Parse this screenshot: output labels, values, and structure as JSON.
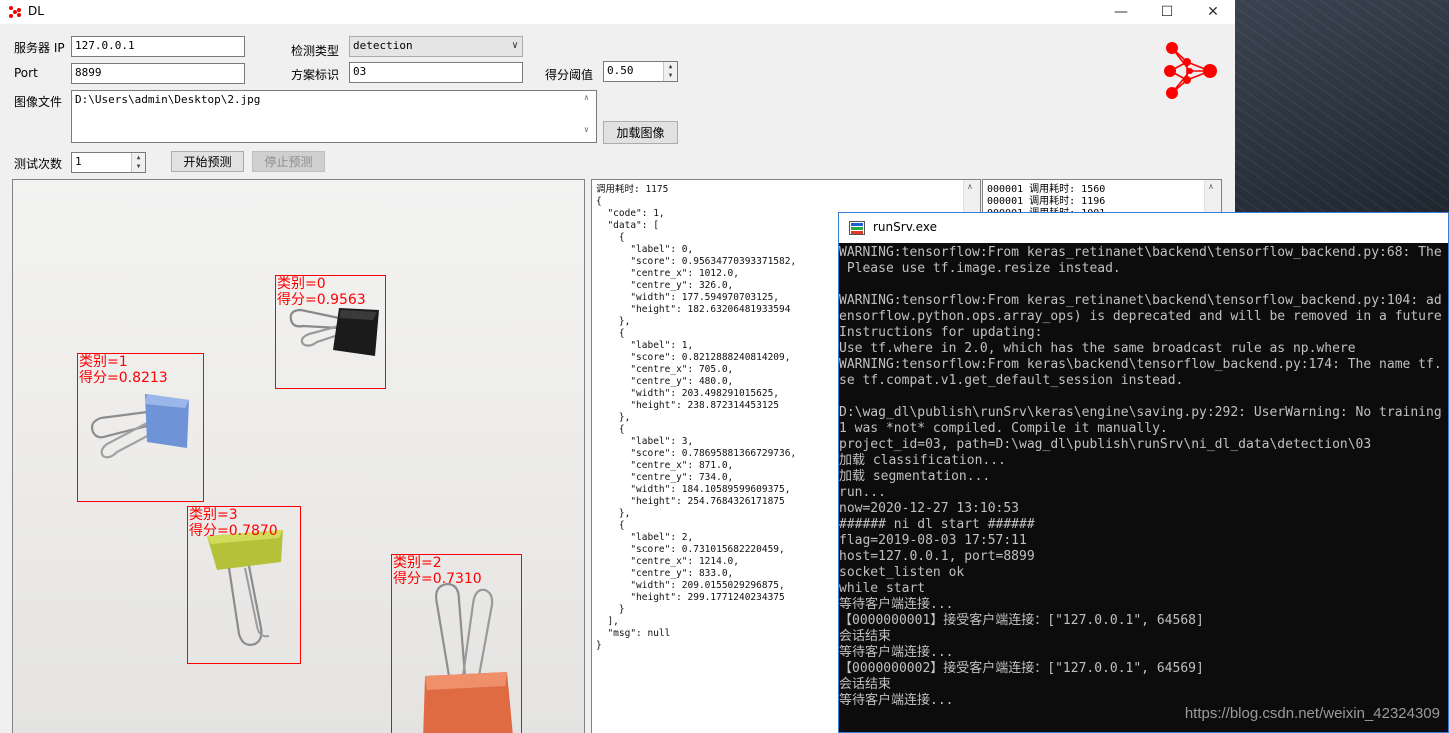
{
  "window": {
    "title": "DL",
    "minimize": "—",
    "maximize": "☐",
    "close": "✕"
  },
  "form": {
    "server_ip_label": "服务器 IP",
    "server_ip_value": "127.0.0.1",
    "port_label": "Port",
    "port_value": "8899",
    "detect_type_label": "检测类型",
    "detect_type_value": "detection",
    "scheme_label": "方案标识",
    "scheme_value": "03",
    "score_threshold_label": "得分阈值",
    "score_threshold_value": "0.50",
    "image_file_label": "图像文件",
    "image_file_value": "D:\\Users\\admin\\Desktop\\2.jpg",
    "load_image_button": "加载图像",
    "test_count_label": "测试次数",
    "test_count_value": "1",
    "start_button": "开始预测",
    "stop_button": "停止预测"
  },
  "detections": [
    {
      "class_label": "类别=0",
      "score_label": "得分=0.9563"
    },
    {
      "class_label": "类别=1",
      "score_label": "得分=0.8213"
    },
    {
      "class_label": "类别=3",
      "score_label": "得分=0.7870"
    },
    {
      "class_label": "类别=2",
      "score_label": "得分=0.7310"
    }
  ],
  "json_output": "调用耗时: 1175\n{\n  \"code\": 1,\n  \"data\": [\n    {\n      \"label\": 0,\n      \"score\": 0.95634770393371582,\n      \"centre_x\": 1012.0,\n      \"centre_y\": 326.0,\n      \"width\": 177.594970703125,\n      \"height\": 182.63206481933594\n    },\n    {\n      \"label\": 1,\n      \"score\": 0.8212888240814209,\n      \"centre_x\": 705.0,\n      \"centre_y\": 480.0,\n      \"width\": 203.498291015625,\n      \"height\": 238.872314453125\n    },\n    {\n      \"label\": 3,\n      \"score\": 0.78695881366729736,\n      \"centre_x\": 871.0,\n      \"centre_y\": 734.0,\n      \"width\": 184.10589599609375,\n      \"height\": 254.7684326171875\n    },\n    {\n      \"label\": 2,\n      \"score\": 0.731015682220459,\n      \"centre_x\": 1214.0,\n      \"centre_y\": 833.0,\n      \"width\": 209.0155029296875,\n      \"height\": 299.1771240234375\n    }\n  ],\n  \"msg\": null\n}",
  "log_output": "000001 调用耗时: 1560\n000001 调用耗时: 1196\n000001 调用耗时: 1001",
  "console": {
    "title": "runSrv.exe",
    "body": "WARNING:tensorflow:From keras_retinanet\\backend\\tensorflow_backend.py:68: The\n Please use tf.image.resize instead.\n\nWARNING:tensorflow:From keras_retinanet\\backend\\tensorflow_backend.py:104: ad\nensorflow.python.ops.array_ops) is deprecated and will be removed in a future\nInstructions for updating:\nUse tf.where in 2.0, which has the same broadcast rule as np.where\nWARNING:tensorflow:From keras\\backend\\tensorflow_backend.py:174: The name tf.\nse tf.compat.v1.get_default_session instead.\n\nD:\\wag_dl\\publish\\runSrv\\keras\\engine\\saving.py:292: UserWarning: No training\n1 was *not* compiled. Compile it manually.\nproject_id=03, path=D:\\wag_dl\\publish\\runSrv\\ni_dl_data\\detection\\03\n加载 classification...\n加载 segmentation...\nrun...\nnow=2020-12-27 13:10:53\n###### ni dl start ######\nflag=2019-08-03 17:57:11\nhost=127.0.0.1, port=8899\nsocket_listen ok\nwhile start\n等待客户端连接...\n【0000000001】接受客户端连接：[\"127.0.0.1\", 64568]\n会话结束\n等待客户端连接...\n【0000000002】接受客户端连接：[\"127.0.0.1\", 64569]\n会话结束\n等待客户端连接...",
    "watermark": "https://blog.csdn.net/weixin_42324309"
  },
  "colors": {
    "detection_box": "#ff0000",
    "logo": "#ff0000",
    "console_bg": "#0c0c0c"
  }
}
